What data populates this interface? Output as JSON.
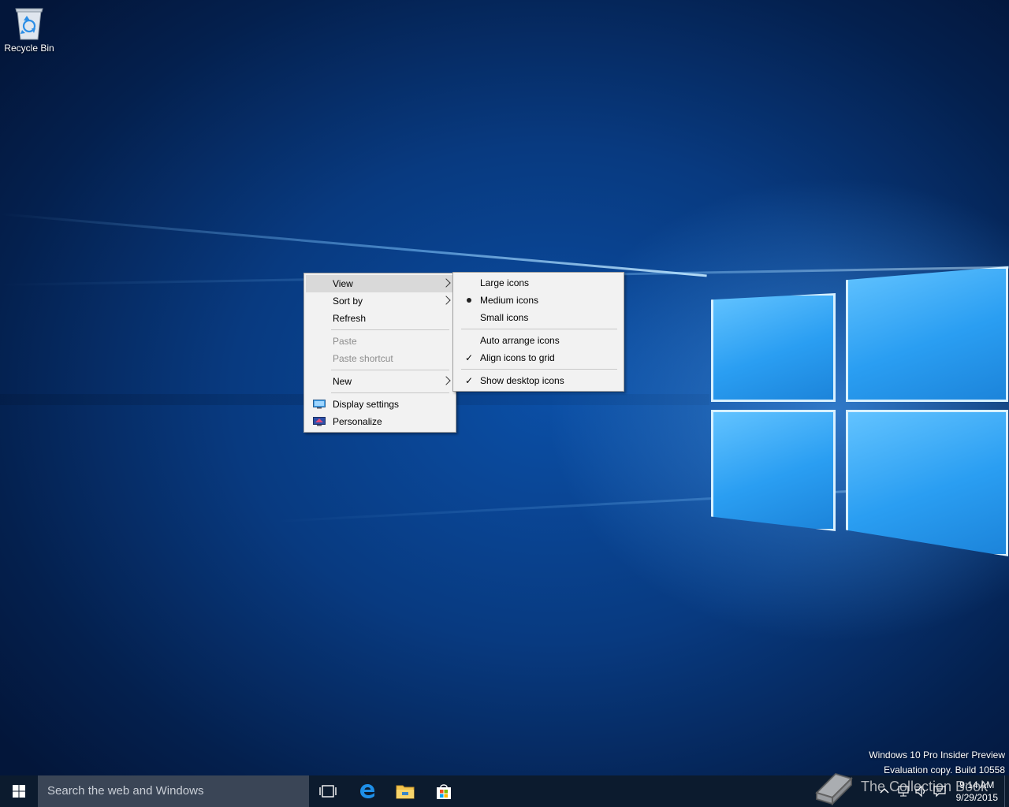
{
  "desktop": {
    "icons": [
      {
        "label": "Recycle Bin",
        "icon": "recycle-bin-icon"
      }
    ]
  },
  "context_menu": {
    "items": [
      {
        "label": "View",
        "submenu": true,
        "highlighted": true,
        "enabled": true
      },
      {
        "label": "Sort by",
        "submenu": true,
        "enabled": true
      },
      {
        "label": "Refresh",
        "enabled": true
      },
      {
        "label": "Paste",
        "enabled": false
      },
      {
        "label": "Paste shortcut",
        "enabled": false
      },
      {
        "label": "New",
        "submenu": true,
        "enabled": true
      },
      {
        "label": "Display settings",
        "icon": "display-settings-icon",
        "enabled": true
      },
      {
        "label": "Personalize",
        "icon": "personalize-icon",
        "enabled": true
      }
    ]
  },
  "view_submenu": {
    "items": [
      {
        "label": "Large icons",
        "mark": "none"
      },
      {
        "label": "Medium icons",
        "mark": "bullet"
      },
      {
        "label": "Small icons",
        "mark": "none"
      },
      {
        "label": "Auto arrange icons",
        "mark": "none"
      },
      {
        "label": "Align icons to grid",
        "mark": "check"
      },
      {
        "label": "Show desktop icons",
        "mark": "check"
      }
    ]
  },
  "watermark": {
    "line1": "Windows 10 Pro Insider Preview",
    "line2": "Evaluation copy. Build 10558"
  },
  "taskbar": {
    "search_placeholder": "Search the web and Windows",
    "pinned": [
      "task-view-icon",
      "edge-icon",
      "file-explorer-icon",
      "store-icon"
    ],
    "clock_time": "9:14 AM",
    "clock_date": "9/29/2015"
  },
  "overlay_mark": "The Collection Book",
  "colors": {
    "menu_bg": "#f2f2f2",
    "menu_highlight": "#d9d9d9",
    "taskbar_bg": "#0c1b2e",
    "search_bg": "#3a4556"
  }
}
